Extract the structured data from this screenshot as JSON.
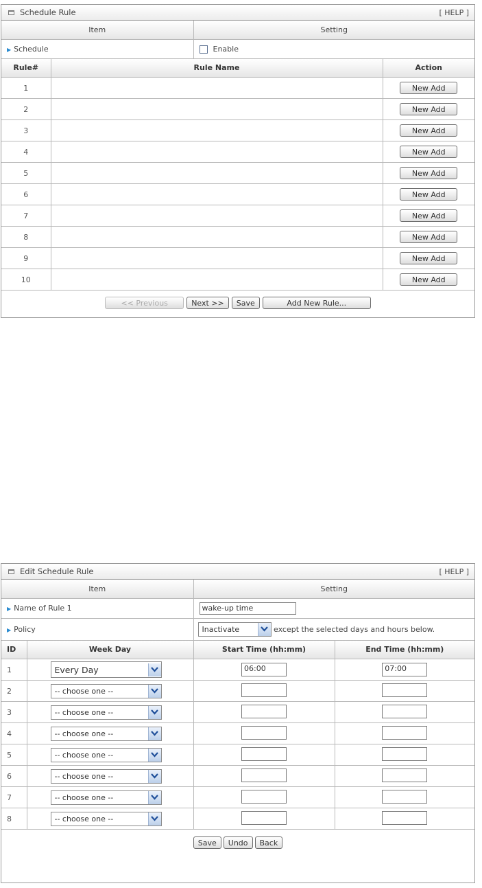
{
  "schedule_panel": {
    "title": "Schedule Rule",
    "help": "[ HELP ]",
    "col_item": "Item",
    "col_setting": "Setting",
    "schedule_label": "Schedule",
    "enable_label": "Enable",
    "col_rule": "Rule#",
    "col_rule_name": "Rule Name",
    "col_action": "Action",
    "rules": [
      {
        "num": "1",
        "name": "",
        "action": "New Add"
      },
      {
        "num": "2",
        "name": "",
        "action": "New Add"
      },
      {
        "num": "3",
        "name": "",
        "action": "New Add"
      },
      {
        "num": "4",
        "name": "",
        "action": "New Add"
      },
      {
        "num": "5",
        "name": "",
        "action": "New Add"
      },
      {
        "num": "6",
        "name": "",
        "action": "New Add"
      },
      {
        "num": "7",
        "name": "",
        "action": "New Add"
      },
      {
        "num": "8",
        "name": "",
        "action": "New Add"
      },
      {
        "num": "9",
        "name": "",
        "action": "New Add"
      },
      {
        "num": "10",
        "name": "",
        "action": "New Add"
      }
    ],
    "btn_previous": "<< Previous",
    "btn_next": "Next >>",
    "btn_save": "Save",
    "btn_add_rule": "Add New Rule..."
  },
  "edit_panel": {
    "title": "Edit Schedule Rule",
    "help": "[ HELP ]",
    "col_item": "Item",
    "col_setting": "Setting",
    "name_label": "Name of Rule 1",
    "name_value": "wake-up time",
    "policy_label": "Policy",
    "policy_value": "Inactivate",
    "policy_suffix": "except the selected days and hours below.",
    "col_id": "ID",
    "col_weekday": "Week Day",
    "col_start": "Start Time (hh:mm)",
    "col_end": "End Time (hh:mm)",
    "rows": [
      {
        "id": "1",
        "day": "Every Day",
        "start": "06:00",
        "end": "07:00"
      },
      {
        "id": "2",
        "day": "-- choose one --",
        "start": "",
        "end": ""
      },
      {
        "id": "3",
        "day": "-- choose one --",
        "start": "",
        "end": ""
      },
      {
        "id": "4",
        "day": "-- choose one --",
        "start": "",
        "end": ""
      },
      {
        "id": "5",
        "day": "-- choose one --",
        "start": "",
        "end": ""
      },
      {
        "id": "6",
        "day": "-- choose one --",
        "start": "",
        "end": ""
      },
      {
        "id": "7",
        "day": "-- choose one --",
        "start": "",
        "end": ""
      },
      {
        "id": "8",
        "day": "-- choose one --",
        "start": "",
        "end": ""
      }
    ],
    "btn_save": "Save",
    "btn_undo": "Undo",
    "btn_back": "Back"
  },
  "colors": {
    "arrow": "#2a8bd0",
    "dropdown": "#bcd0ea"
  }
}
